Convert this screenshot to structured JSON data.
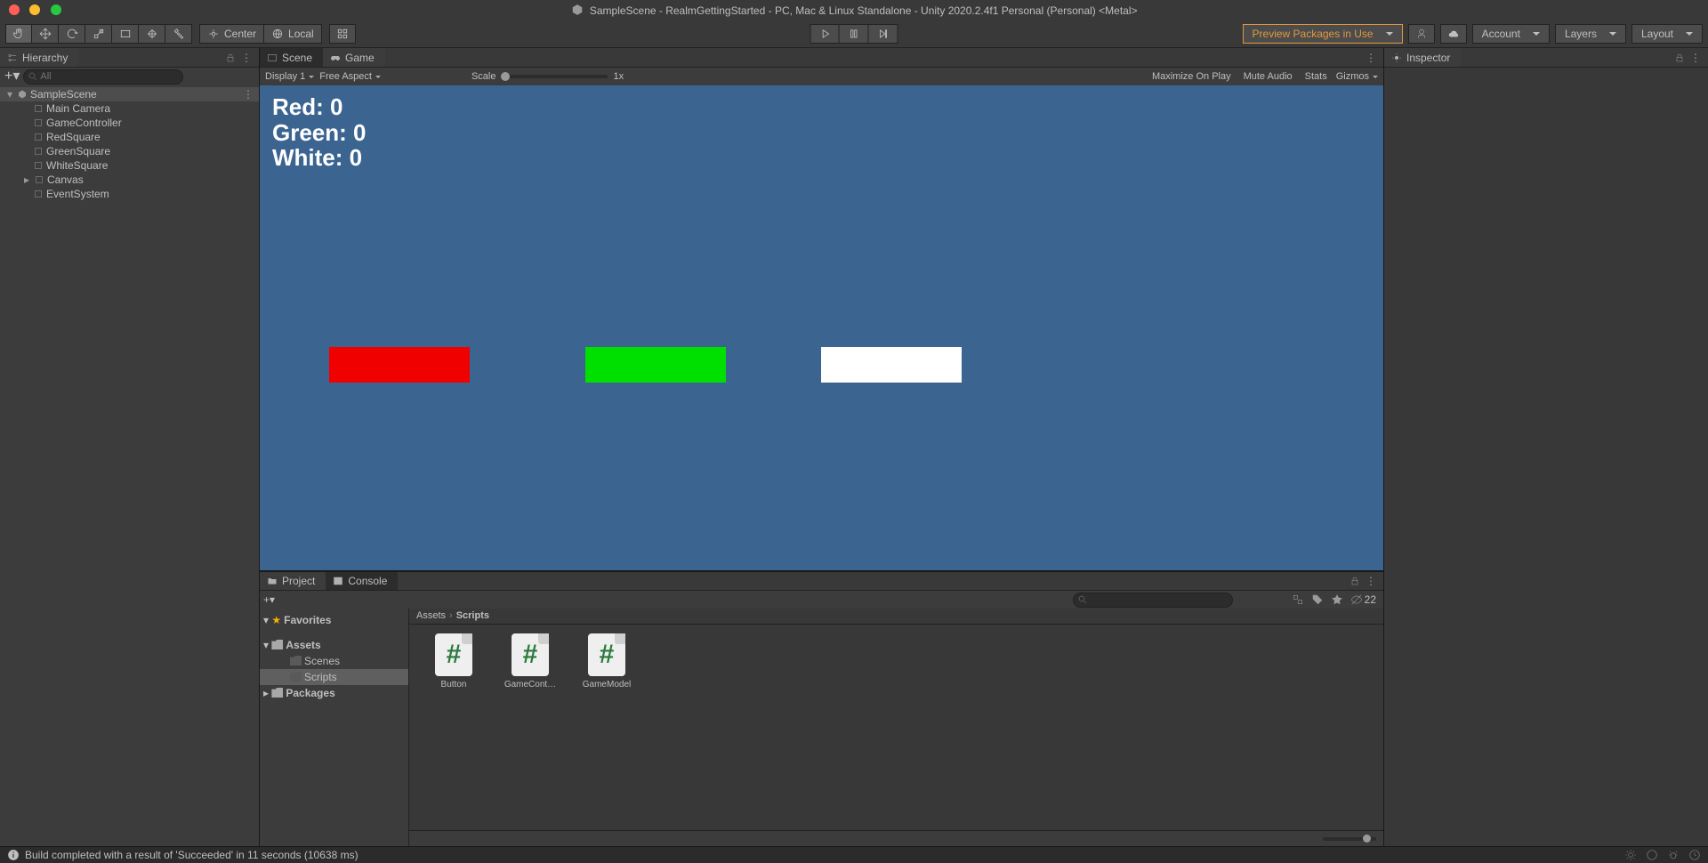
{
  "title": "SampleScene - RealmGettingStarted - PC, Mac & Linux Standalone - Unity 2020.2.4f1 Personal (Personal) <Metal>",
  "toolbar": {
    "pivot_mode": "Center",
    "handle_space": "Local",
    "preview_label": "Preview Packages in Use",
    "account_label": "Account",
    "layers_label": "Layers",
    "layout_label": "Layout"
  },
  "hierarchy": {
    "tab": "Hierarchy",
    "search_placeholder": "All",
    "scene": "SampleScene",
    "items": [
      "Main Camera",
      "GameController",
      "RedSquare",
      "GreenSquare",
      "WhiteSquare",
      "Canvas",
      "EventSystem"
    ]
  },
  "scene_tab": "Scene",
  "game_tab": "Game",
  "game_toolbar": {
    "display": "Display 1",
    "aspect": "Free Aspect",
    "scale_label": "Scale",
    "scale_value": "1x",
    "max_on_play": "Maximize On Play",
    "mute_audio": "Mute Audio",
    "stats": "Stats",
    "gizmos": "Gizmos"
  },
  "game_view": {
    "score_lines": [
      "Red: 0",
      "Green: 0",
      "White: 0"
    ],
    "scores": {
      "red": 0,
      "green": 0,
      "white": 0
    },
    "colors": {
      "background": "#3b6491",
      "red": "#f10000",
      "green": "#00e000",
      "white": "#ffffff"
    }
  },
  "project": {
    "tab_project": "Project",
    "tab_console": "Console",
    "favorites": "Favorites",
    "assets": "Assets",
    "scenes": "Scenes",
    "scripts": "Scripts",
    "packages": "Packages",
    "breadcrumb": [
      "Assets",
      "Scripts"
    ],
    "items": [
      {
        "name": "Button"
      },
      {
        "name": "GameCont…"
      },
      {
        "name": "GameModel"
      }
    ],
    "hidden_count": "22"
  },
  "inspector": {
    "tab": "Inspector"
  },
  "status": {
    "message": "Build completed with a result of 'Succeeded' in 11 seconds (10638 ms)"
  }
}
